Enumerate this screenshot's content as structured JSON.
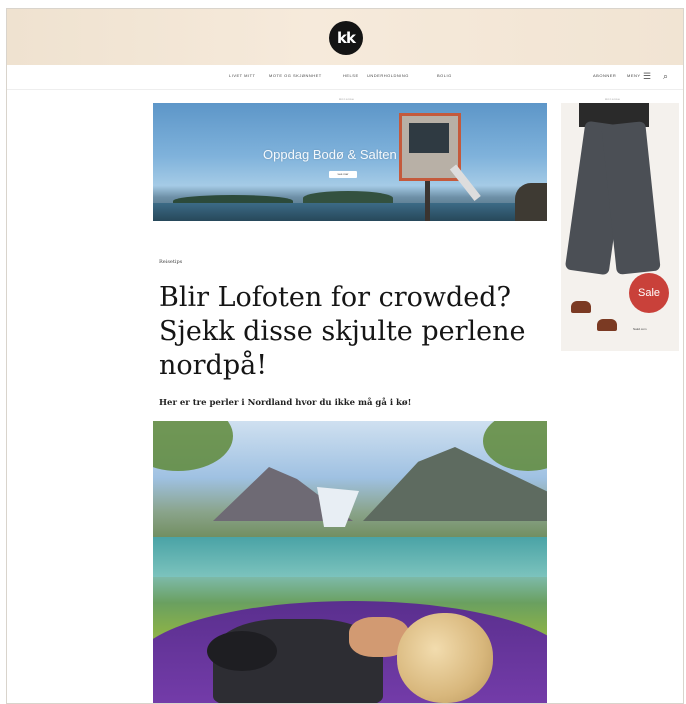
{
  "site": {
    "logo_text": "kk"
  },
  "nav": {
    "items": [
      "Livet mitt",
      "Mote og skjønnhet",
      "Helse",
      "Underholdning",
      "Bolig"
    ],
    "right_items": [
      "Abonner",
      "Meny"
    ]
  },
  "banner_ad": {
    "label": "Annonse",
    "title": "Oppdag Bodø & Salten",
    "button": "Les mer"
  },
  "side_ad": {
    "label": "Annonse",
    "badge": "Sale",
    "brand": "Nakd.com"
  },
  "article": {
    "kicker": "Reisetips",
    "headline": "Blir Lofoten for crowded? Sjekk disse skjulte perlene nordpå!",
    "subheadline": "Her er tre perler i Nordland hvor du ikke må gå i kø!"
  },
  "colors": {
    "header_bg": "#f4e8d8",
    "sale_badge": "#c9413a",
    "text": "#151515"
  }
}
